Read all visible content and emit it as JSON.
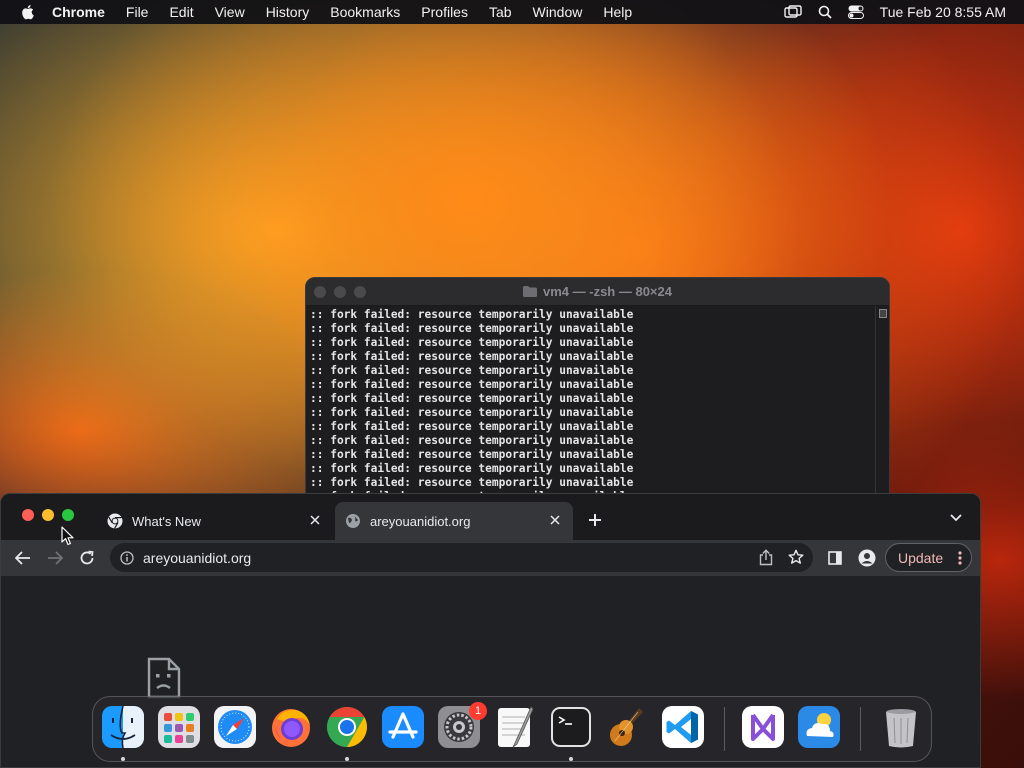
{
  "menubar": {
    "app_name": "Chrome",
    "items": [
      "File",
      "Edit",
      "View",
      "History",
      "Bookmarks",
      "Profiles",
      "Tab",
      "Window",
      "Help"
    ],
    "clock": "Tue Feb 20  8:55 AM",
    "status_icons": [
      "screen-mirroring-icon",
      "spotlight-search-icon",
      "control-center-icon"
    ]
  },
  "terminal": {
    "title": "vm4 — -zsh — 80×24",
    "lines": [
      ":: fork failed: resource temporarily unavailable",
      ":: fork failed: resource temporarily unavailable",
      ":: fork failed: resource temporarily unavailable",
      ":: fork failed: resource temporarily unavailable",
      ":: fork failed: resource temporarily unavailable",
      ":: fork failed: resource temporarily unavailable",
      ":: fork failed: resource temporarily unavailable",
      ":: fork failed: resource temporarily unavailable",
      ":: fork failed: resource temporarily unavailable",
      ":: fork failed: resource temporarily unavailable",
      ":: fork failed: resource temporarily unavailable",
      ":: fork failed: resource temporarily unavailable",
      ":: fork failed: resource temporarily unavailable",
      ":: fork failed: resource temporarily unavailable"
    ]
  },
  "chrome": {
    "tabs": [
      {
        "title": "What's New",
        "active": false
      },
      {
        "title": "areyouanidiot.org",
        "active": true
      }
    ],
    "url": "areyouanidiot.org",
    "update_label": "Update"
  },
  "dock": {
    "apps": [
      "Finder",
      "Launchpad",
      "Safari",
      "Firefox",
      "Google Chrome",
      "App Store",
      "System Settings",
      "TextEdit",
      "Terminal",
      "GarageBand",
      "Visual Studio Code",
      "Visual Studio",
      "Weather",
      "Trash"
    ],
    "settings_badge": "1"
  },
  "colors": {
    "close": "#ff5f57",
    "minimize": "#febc2e",
    "zoom": "#28c840",
    "update_text": "#f2b8b5",
    "badge": "#ff3b30"
  }
}
